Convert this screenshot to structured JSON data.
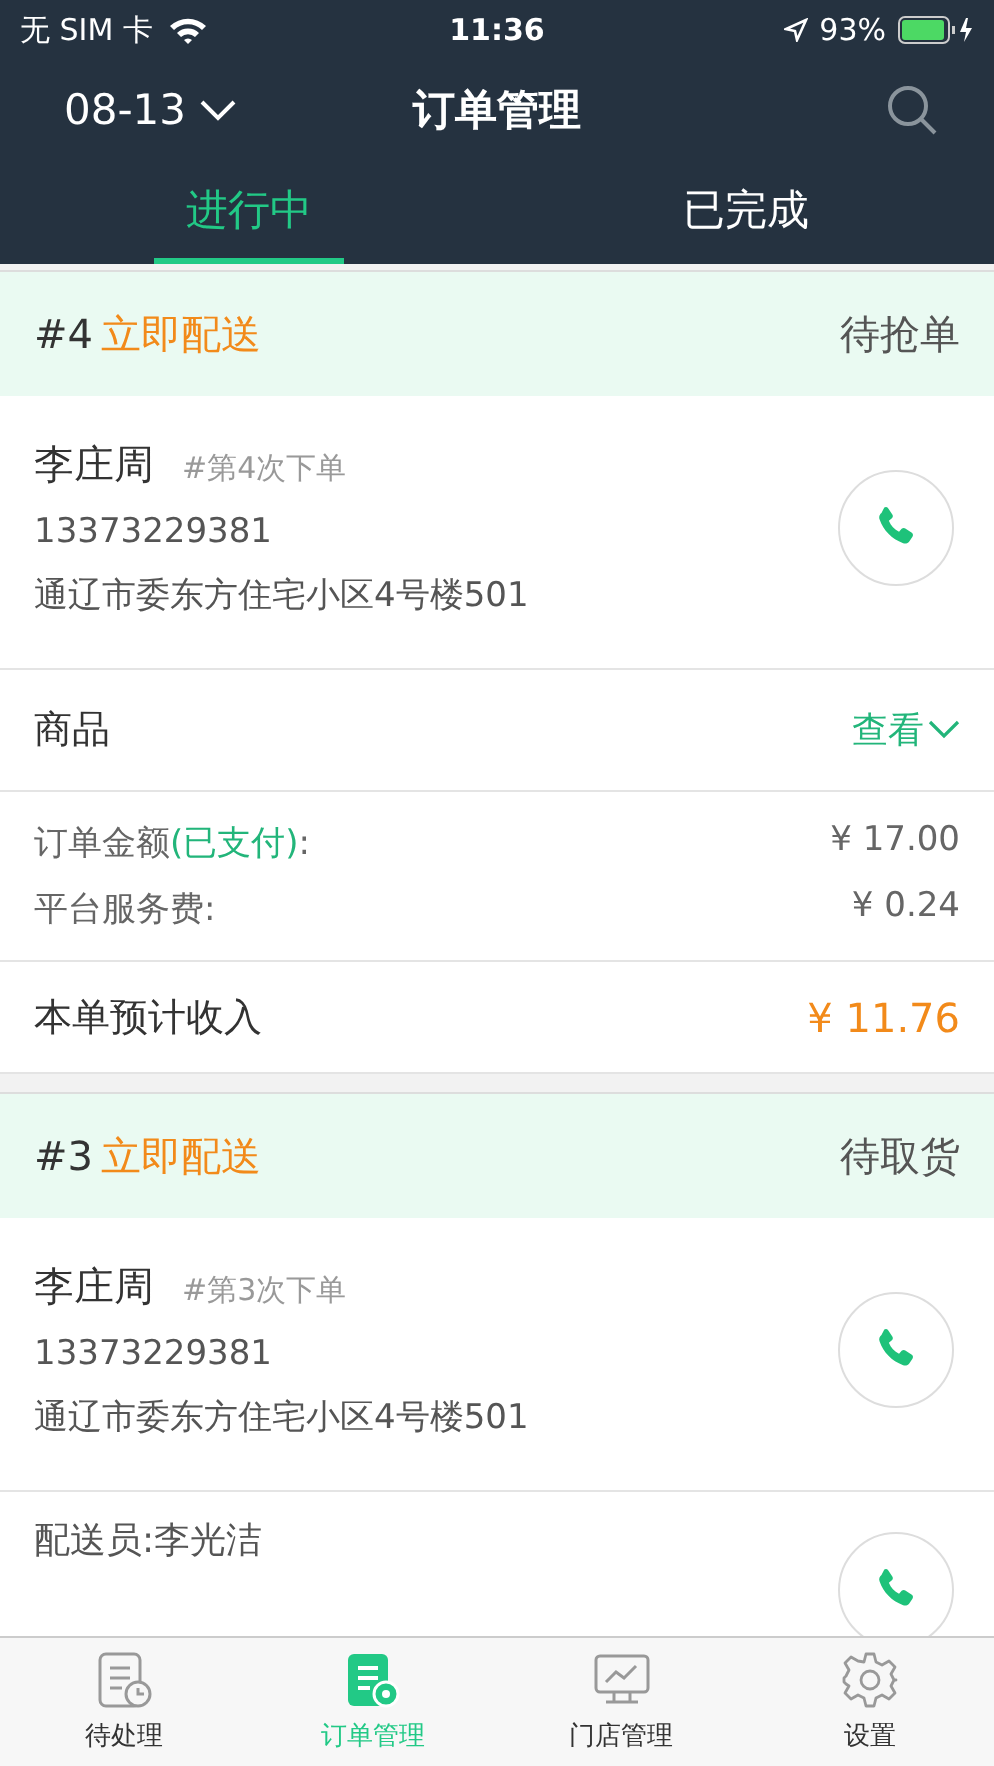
{
  "status_bar": {
    "carrier": "无 SIM 卡",
    "time": "11:36",
    "battery_percent": "93%"
  },
  "nav": {
    "date": "08-13",
    "title": "订单管理"
  },
  "tabs": [
    {
      "label": "进行中",
      "selected": true
    },
    {
      "label": "已完成",
      "selected": false
    }
  ],
  "orders": [
    {
      "number": "#4",
      "action": "立即配送",
      "status": "待抢单",
      "customer": "李庄周",
      "order_count": "#第4次下单",
      "phone": "13373229381",
      "address": "通辽市委东方住宅小区4号楼501",
      "goods_label": "商品",
      "goods_link": "查看",
      "amount_label": "订单金额",
      "payment_status": "(已支付)",
      "amount_suffix": ":",
      "amount": "¥ 17.00",
      "fee_label": "平台服务费:",
      "fee": "¥ 0.24",
      "income_label": "本单预计收入",
      "income": "¥ 11.76"
    },
    {
      "number": "#3",
      "action": "立即配送",
      "status": "待取货",
      "customer": "李庄周",
      "order_count": "#第3次下单",
      "phone": "13373229381",
      "address": "通辽市委东方住宅小区4号楼501",
      "courier": "配送员:李光洁"
    }
  ],
  "bottom_tabs": [
    {
      "label": "待处理",
      "kind": "pending",
      "selected": false
    },
    {
      "label": "订单管理",
      "kind": "orders",
      "selected": true
    },
    {
      "label": "门店管理",
      "kind": "store",
      "selected": false
    },
    {
      "label": "设置",
      "kind": "settings",
      "selected": false
    }
  ]
}
